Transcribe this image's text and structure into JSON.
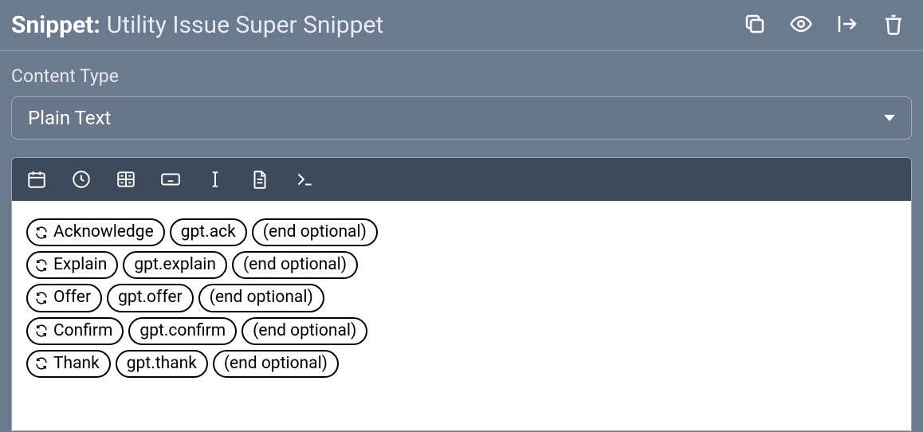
{
  "header": {
    "prefix": "Snippet:",
    "name": "Utility Issue Super Snippet"
  },
  "contentType": {
    "label": "Content Type",
    "value": "Plain Text"
  },
  "rows": [
    {
      "label": "Acknowledge",
      "var": "gpt.ack",
      "end": "(end optional)"
    },
    {
      "label": "Explain",
      "var": "gpt.explain",
      "end": "(end optional)"
    },
    {
      "label": "Offer",
      "var": "gpt.offer",
      "end": "(end optional)"
    },
    {
      "label": "Confirm",
      "var": "gpt.confirm",
      "end": "(end optional)"
    },
    {
      "label": "Thank",
      "var": "gpt.thank",
      "end": "(end optional)"
    }
  ]
}
